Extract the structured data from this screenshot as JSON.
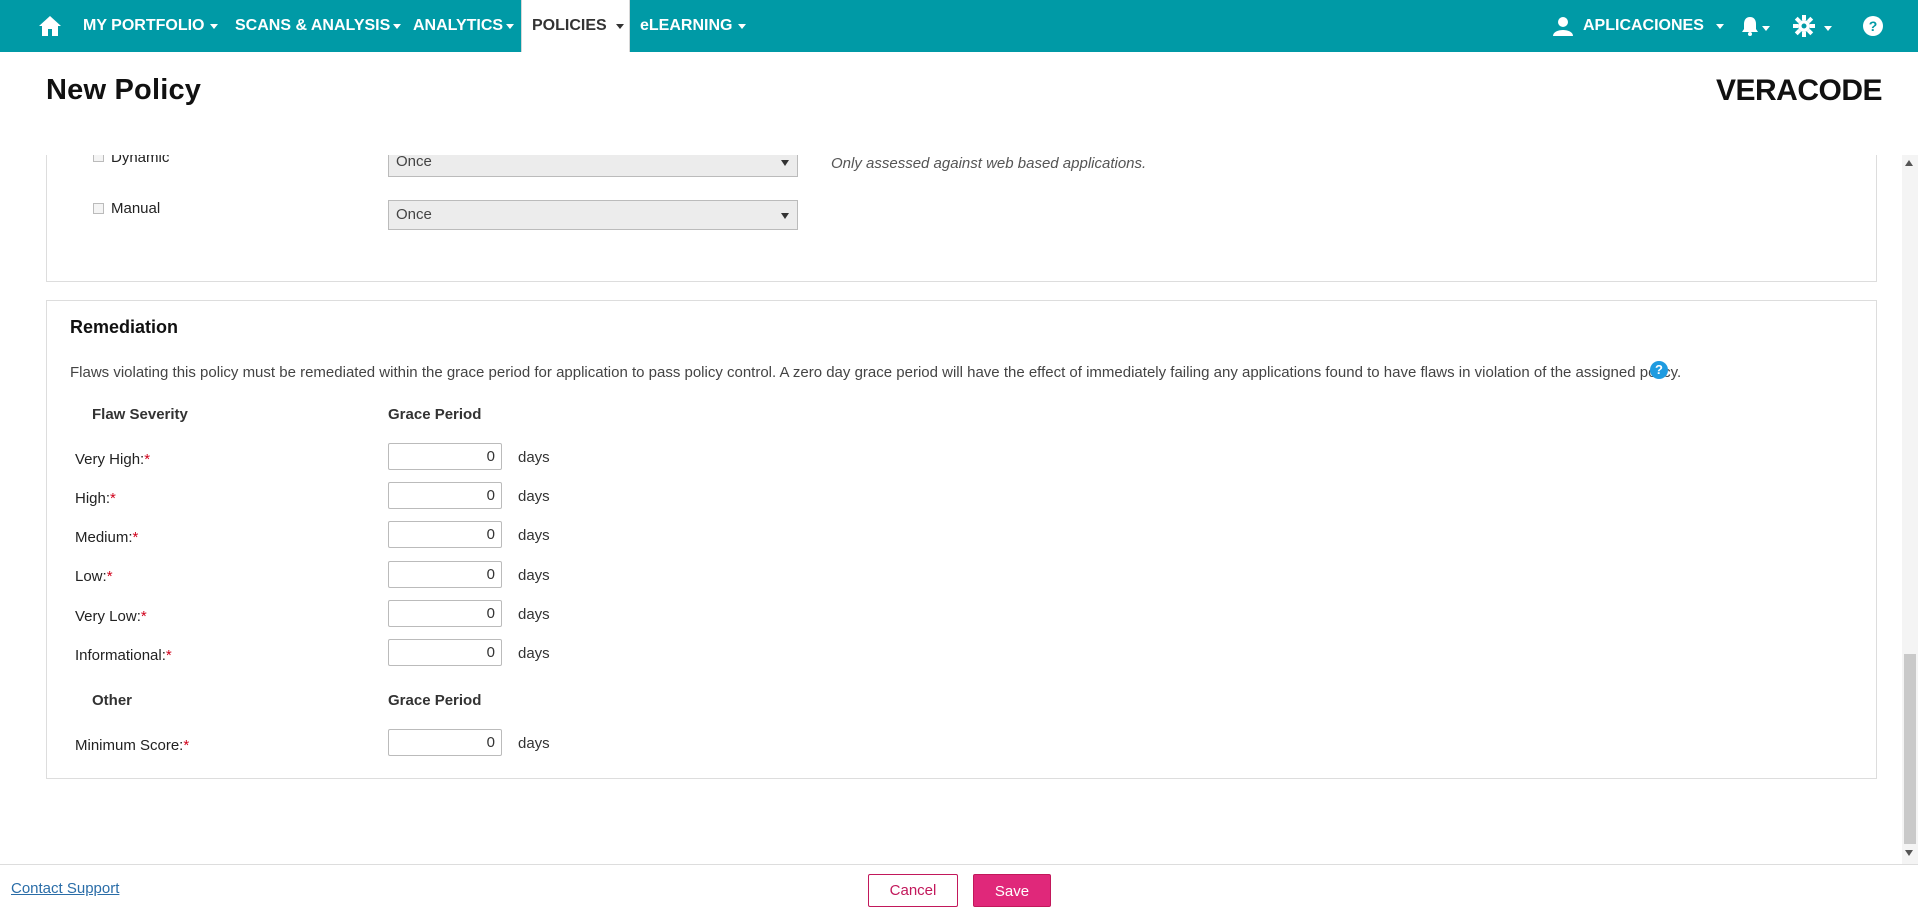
{
  "nav": {
    "items": [
      {
        "label": "MY PORTFOLIO"
      },
      {
        "label": "SCANS & ANALYSIS"
      },
      {
        "label": "ANALYTICS"
      },
      {
        "label": "POLICIES"
      },
      {
        "label": "eLEARNING"
      }
    ],
    "user_label": "APLICACIONES"
  },
  "header": {
    "title": "New Policy",
    "logo_text": "VERACODE"
  },
  "scan_frequency": {
    "rows": [
      {
        "label": "Dynamic",
        "selected": "Once",
        "note": "Only assessed against web based applications."
      },
      {
        "label": "Manual",
        "selected": "Once"
      }
    ]
  },
  "remediation": {
    "title": "Remediation",
    "description": "Flaws violating this policy must be remediated within the grace period for application to pass policy control. A zero day grace period will have the effect of immediately failing any applications found to have flaws in violation of the assigned policy.",
    "severity_header": "Flaw Severity",
    "grace_header": "Grace Period",
    "required_mark": "*",
    "unit": "days",
    "rows": [
      {
        "label": "Very High:",
        "value": "0"
      },
      {
        "label": "High:",
        "value": "0"
      },
      {
        "label": "Medium:",
        "value": "0"
      },
      {
        "label": "Low:",
        "value": "0"
      },
      {
        "label": "Very Low:",
        "value": "0"
      },
      {
        "label": "Informational:",
        "value": "0"
      }
    ],
    "other_header": "Other",
    "other_grace_header": "Grace Period",
    "other_rows": [
      {
        "label": "Minimum Score:",
        "value": "0"
      }
    ]
  },
  "footer": {
    "contact_label": "Contact Support",
    "cancel_label": "Cancel",
    "save_label": "Save"
  }
}
